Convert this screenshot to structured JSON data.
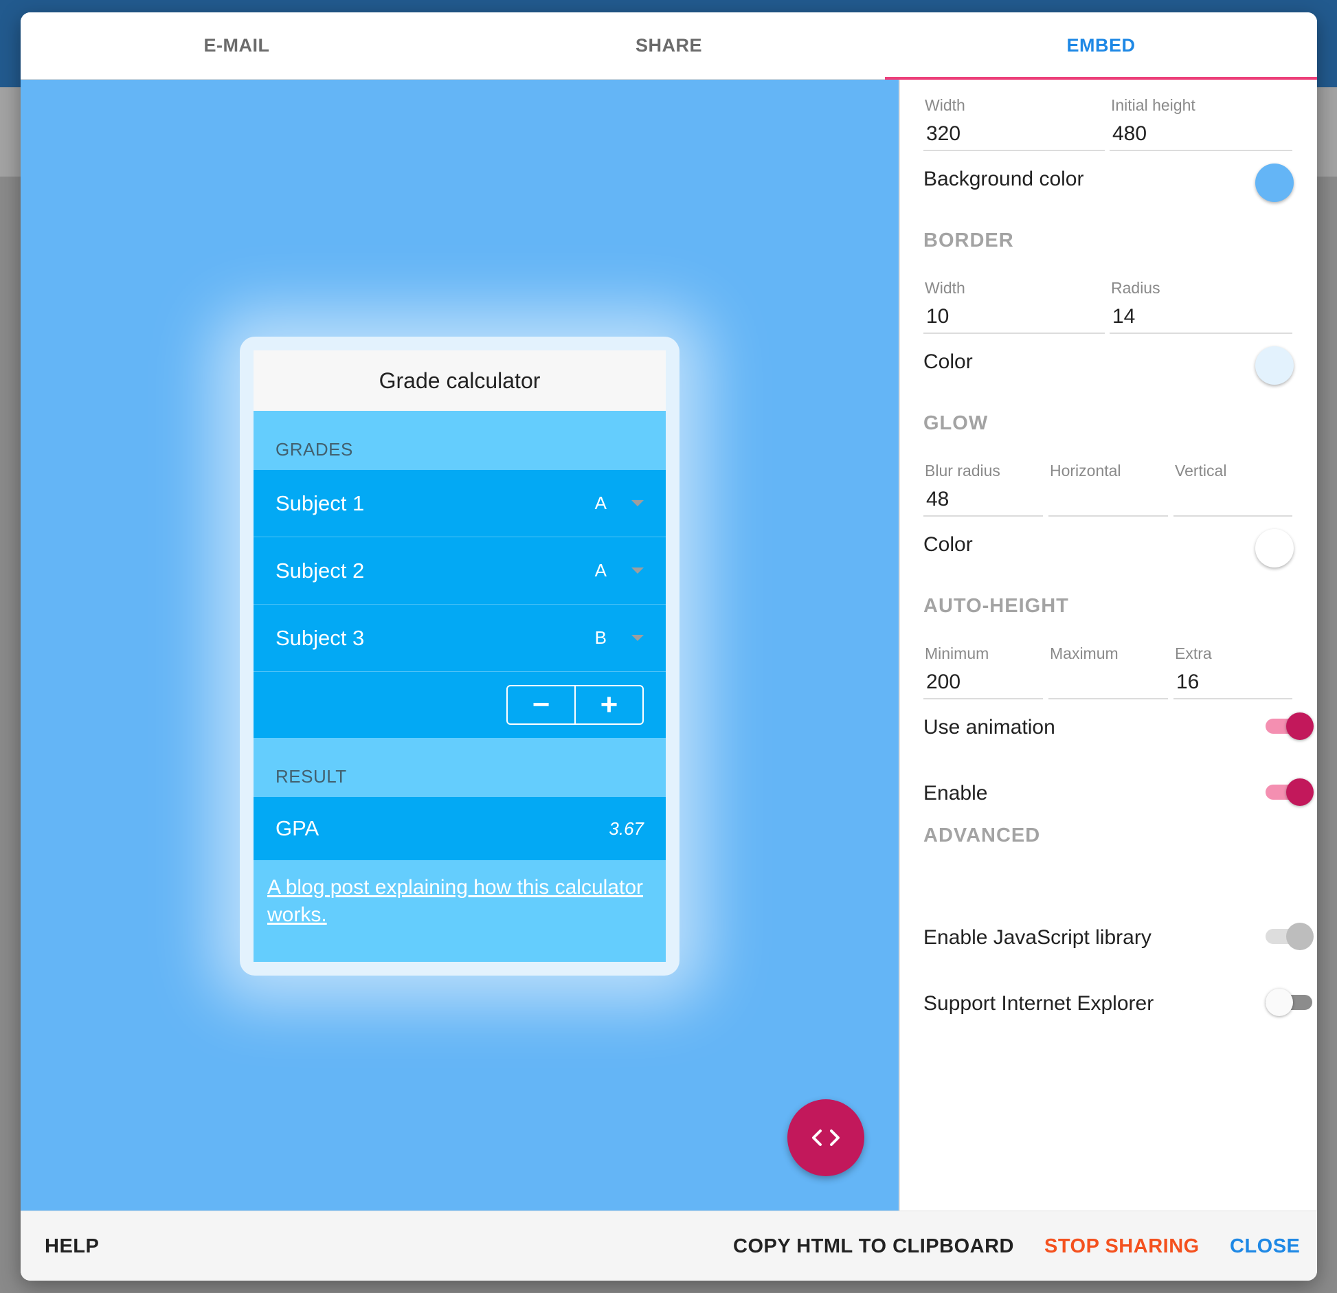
{
  "tabs": [
    {
      "label": "E-MAIL",
      "active": false
    },
    {
      "label": "SHARE",
      "active": false
    },
    {
      "label": "EMBED",
      "active": true
    }
  ],
  "preview": {
    "background_color": "#64b5f6",
    "widget": {
      "title": "Grade calculator",
      "grades_label": "GRADES",
      "subjects": [
        {
          "name": "Subject 1",
          "grade": "A"
        },
        {
          "name": "Subject 2",
          "grade": "A"
        },
        {
          "name": "Subject 3",
          "grade": "B"
        }
      ],
      "minus_glyph": "−",
      "plus_glyph": "+",
      "result_label": "RESULT",
      "result_name": "GPA",
      "result_value": "3.67",
      "link_text": "A blog post explaining how this calculator works."
    },
    "fab_icon": "code-icon"
  },
  "settings": {
    "width_label": "Width",
    "width_value": "320",
    "initial_height_label": "Initial height",
    "initial_height_value": "480",
    "background_color_label": "Background color",
    "background_color": "#64b5f6",
    "border": {
      "heading": "BORDER",
      "width_label": "Width",
      "width_value": "10",
      "radius_label": "Radius",
      "radius_value": "14",
      "color_label": "Color",
      "color": "#e3f2fd"
    },
    "glow": {
      "heading": "GLOW",
      "blur_label": "Blur radius",
      "blur_value": "48",
      "horizontal_label": "Horizontal",
      "horizontal_value": "",
      "vertical_label": "Vertical",
      "vertical_value": "",
      "color_label": "Color",
      "color": "#ffffff"
    },
    "auto_height": {
      "heading": "AUTO-HEIGHT",
      "minimum_label": "Minimum",
      "minimum_value": "200",
      "maximum_label": "Maximum",
      "maximum_value": "",
      "extra_label": "Extra",
      "extra_value": "16",
      "use_animation_label": "Use animation",
      "use_animation": true,
      "enable_label": "Enable",
      "enable": true
    },
    "advanced": {
      "heading": "ADVANCED",
      "js_library_label": "Enable JavaScript library",
      "js_library": "disabled",
      "ie_support_label": "Support Internet Explorer",
      "ie_support": false
    }
  },
  "footer": {
    "help": "HELP",
    "copy_html": "COPY HTML TO CLIPBOARD",
    "stop_sharing": "STOP SHARING",
    "close": "CLOSE"
  },
  "colors": {
    "accent_tab": "#1e88e5",
    "tab_indicator": "#ec407a",
    "toggle_on": "#c2185b",
    "stop_sharing": "#f4511e",
    "close": "#1e88e5"
  }
}
